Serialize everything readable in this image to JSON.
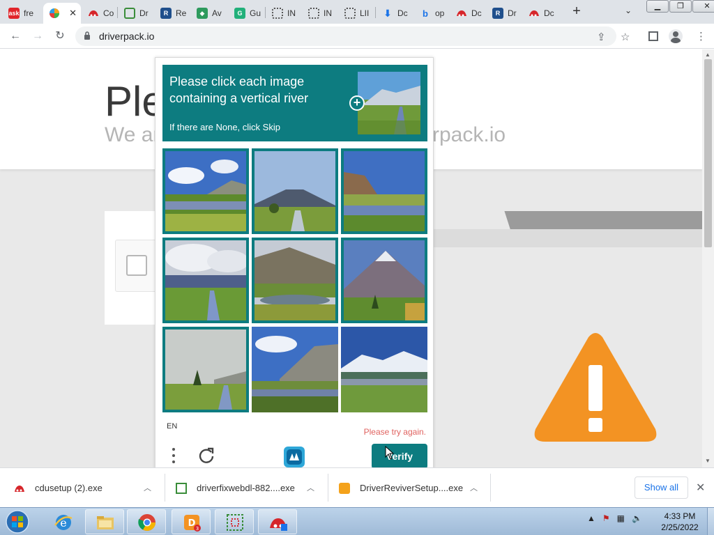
{
  "browser": {
    "tabs": [
      {
        "label": "fre",
        "icon": "ask-icon",
        "color": "#e1252b"
      },
      {
        "label": "",
        "icon": "driverpack-icon",
        "color": "#f4a21b",
        "active": true
      },
      {
        "label": "Co",
        "icon": "cloud-icon",
        "color": "#d6262b"
      },
      {
        "label": "Dr",
        "icon": "grid-icon",
        "color": "#3a8d3a"
      },
      {
        "label": "Re",
        "icon": "reviver-icon",
        "color": "#1f4f8c"
      },
      {
        "label": "Av",
        "icon": "shield-icon",
        "color": "#2e9a5d"
      },
      {
        "label": "Gu",
        "icon": "g-icon",
        "color": "#21b07a"
      },
      {
        "label": "IN",
        "icon": "qr-icon",
        "color": "#555555"
      },
      {
        "label": "IN",
        "icon": "qr-icon",
        "color": "#555555"
      },
      {
        "label": "LII",
        "icon": "qr-icon",
        "color": "#555555"
      },
      {
        "label": "Dc",
        "icon": "download-icon",
        "color": "#1a73e8"
      },
      {
        "label": "op",
        "icon": "bing-icon",
        "color": "#1a73e8"
      },
      {
        "label": "Dc",
        "icon": "cloud-icon",
        "color": "#d6262b"
      },
      {
        "label": "Dr",
        "icon": "reviver-icon",
        "color": "#1f4f8c"
      },
      {
        "label": "Dc",
        "icon": "cloud-icon",
        "color": "#d6262b"
      }
    ],
    "new_tab": "+",
    "tab_search": "⌄",
    "window": {
      "minimize": "▁",
      "restore": "❐",
      "close": "✕"
    },
    "url": "driverpack.io"
  },
  "page": {
    "hero_title": "Ple",
    "hero_subtitle_left": "We ar",
    "hero_subtitle_right": "rpack.io"
  },
  "captcha": {
    "prompt": "Please click each image containing a vertical river",
    "skip_hint": "If there are None, click Skip",
    "language": "EN",
    "error": "Please try again.",
    "verify_label": "Verify",
    "tiles": [
      {
        "selected": true,
        "scene": "sky-clouds"
      },
      {
        "selected": true,
        "scene": "volcano-river"
      },
      {
        "selected": true,
        "scene": "cliff-lake"
      },
      {
        "selected": true,
        "scene": "cloudy-river"
      },
      {
        "selected": true,
        "scene": "hills-pond"
      },
      {
        "selected": true,
        "scene": "peak-tree"
      },
      {
        "selected": true,
        "scene": "misty-tree"
      },
      {
        "selected": false,
        "scene": "cliff-sky"
      },
      {
        "selected": false,
        "scene": "snow-range"
      }
    ]
  },
  "downloads": [
    {
      "file": "cdusetup (2).exe",
      "icon": "cloud-icon"
    },
    {
      "file": "driverfixwebdl-882....exe",
      "icon": "grid-icon"
    },
    {
      "file": "DriverReviverSetup....exe",
      "icon": "reviver-icon"
    }
  ],
  "show_all": "Show all",
  "taskbar": {
    "time": "4:33 PM",
    "date": "2/25/2022"
  },
  "colors": {
    "accent": "#0d7c80",
    "warning": "#f39323",
    "error": "#e0625f"
  }
}
